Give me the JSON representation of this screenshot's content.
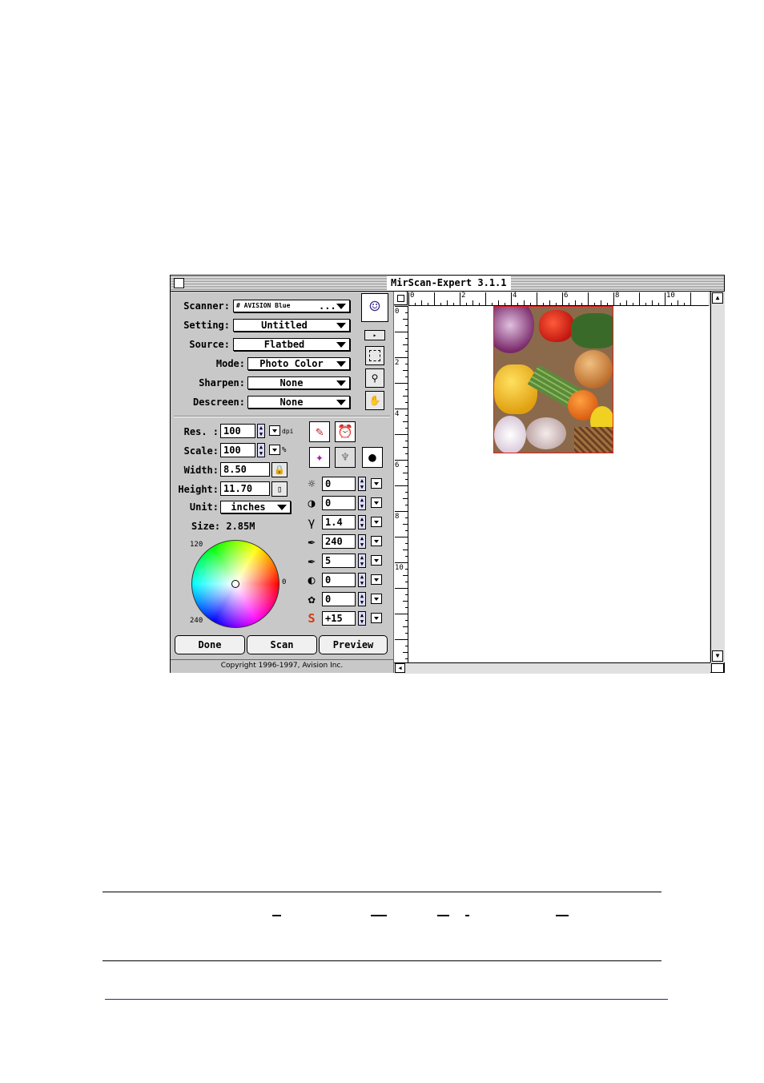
{
  "window": {
    "title": "MirScan-Expert 3.1.1",
    "copyright": "Copyright 1996-1997, Avision Inc."
  },
  "selectors": [
    {
      "label": "Scanner:",
      "value": "# AVISION Blue",
      "extra": "..."
    },
    {
      "label": "Setting:",
      "value": "Untitled"
    },
    {
      "label": "Source:",
      "value": "Flatbed"
    },
    {
      "label": "Mode:",
      "value": "Photo Color"
    },
    {
      "label": "Sharpen:",
      "value": "None"
    },
    {
      "label": "Descreen:",
      "value": "None"
    }
  ],
  "dims": {
    "res_label": "Res. :",
    "res_value": "100",
    "res_unit": "dpi",
    "scale_label": "Scale:",
    "scale_value": "100",
    "scale_unit": "%",
    "width_label": "Width:",
    "width_value": "8.50",
    "height_label": "Height:",
    "height_value": "11.70",
    "unit_label": "Unit:",
    "unit_value": "inches",
    "size_text": "Size: 2.85M"
  },
  "wheel": {
    "label_top": "120",
    "label_right": "0",
    "label_bottom": "240"
  },
  "adjustments": [
    {
      "icon": "brightness-icon",
      "value": "0"
    },
    {
      "icon": "contrast-icon",
      "value": "0"
    },
    {
      "icon": "gamma-icon",
      "value": "1.4"
    },
    {
      "icon": "highlight-eyedropper-icon",
      "value": "240"
    },
    {
      "icon": "shadow-eyedropper-icon",
      "value": "5"
    },
    {
      "icon": "midtone-icon",
      "value": "0"
    },
    {
      "icon": "hue-icon",
      "value": "0"
    },
    {
      "icon": "saturation-icon",
      "value": "+15"
    }
  ],
  "buttons": {
    "done": "Done",
    "scan": "Scan",
    "preview": "Preview"
  },
  "ruler": {
    "top": [
      "0",
      "2",
      "4",
      "6",
      "8",
      "10"
    ],
    "left": [
      "0",
      "2",
      "4",
      "6",
      "8",
      "10"
    ]
  },
  "preview_image": {
    "description_colors": [
      "#7a2a6a",
      "#d42a1a",
      "#f2c020",
      "#4a8a3a",
      "#e07820"
    ]
  }
}
